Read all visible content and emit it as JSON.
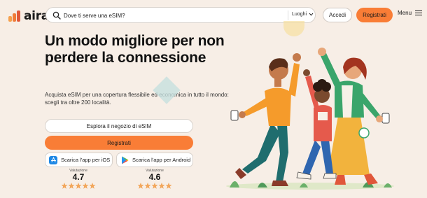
{
  "header": {
    "logo_text": "airalo",
    "search_placeholder": "Dove ti serve una eSIM?",
    "search_scope": "Luoghi",
    "login_label": "Accedi",
    "register_label": "Registrati",
    "menu_label": "Menu"
  },
  "hero": {
    "title": "Un modo migliore per non perdere la connessione",
    "subtitle": "Acquista eSIM per una copertura flessibile ed economica in tutto il mondo: scegli tra oltre 200 località.",
    "explore_label": "Esplora il negozio di eSIM",
    "register_label": "Registrati"
  },
  "apps": {
    "ios": {
      "label": "Scarica l'app per iOS",
      "rating_label": "Valutazione",
      "rating": "4.7",
      "stars": 5
    },
    "android": {
      "label": "Scarica l'app per Android",
      "rating_label": "Valutazione",
      "rating": "4.6",
      "stars": 5
    }
  },
  "icons": [
    "search-icon",
    "chevron-down-icon",
    "hamburger-icon",
    "app-store-icon",
    "google-play-icon",
    "star-icon"
  ],
  "colors": {
    "accent": "#f97d36",
    "background": "#f7eee6",
    "star": "#f2a65a"
  }
}
